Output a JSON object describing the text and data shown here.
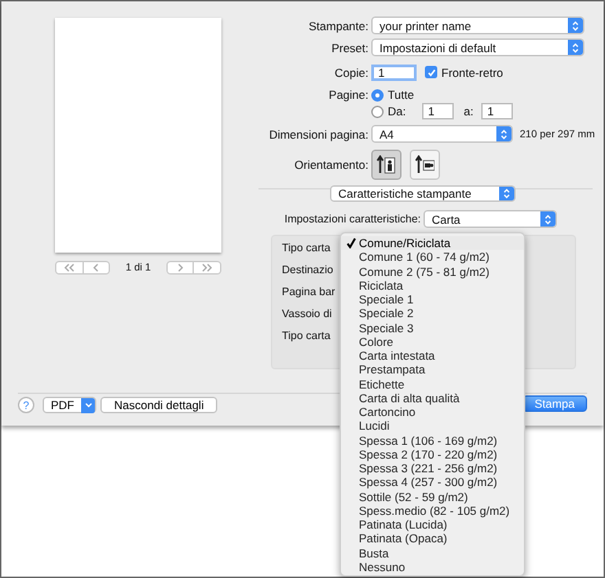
{
  "preview": {
    "page_indicator": "1 di 1"
  },
  "printer": {
    "label": "Stampante:",
    "value": "your printer name"
  },
  "preset": {
    "label": "Preset:",
    "value": "Impostazioni di default"
  },
  "copies": {
    "label": "Copie:",
    "value": "1",
    "duplex": {
      "label": "Fronte-retro",
      "checked": true
    }
  },
  "pages": {
    "label": "Pagine:",
    "options": [
      {
        "label": "Tutte",
        "selected": true
      },
      {
        "label": "Da:",
        "selected": false
      }
    ],
    "from": "1",
    "to_label": "a:",
    "to": "1"
  },
  "page_size": {
    "label": "Dimensioni pagina:",
    "value": "A4",
    "dimensions": "210 per 297 mm"
  },
  "orientation": {
    "label": "Orientamento:",
    "options": [
      {
        "kind": "portrait",
        "selected": true
      },
      {
        "kind": "landscape",
        "selected": false
      }
    ]
  },
  "section_popup": "Caratteristiche stampante",
  "feature_set": {
    "label": "Impostazioni caratteristiche:",
    "value": "Carta"
  },
  "feature_labels": [
    "Tipo carta",
    "Destinazio",
    "Pagina bar",
    "Vassoio di",
    "Tipo carta"
  ],
  "paper_menu": [
    {
      "label": "Comune/Riciclata",
      "selected": true
    },
    {
      "label": "Comune 1 (60 - 74 g/m2)",
      "selected": false
    },
    {
      "label": "Comune 2 (75 - 81 g/m2)",
      "selected": false
    },
    {
      "label": "Riciclata",
      "selected": false
    },
    {
      "label": "Speciale 1",
      "selected": false
    },
    {
      "label": "Speciale 2",
      "selected": false
    },
    {
      "label": "Speciale 3",
      "selected": false
    },
    {
      "label": "Colore",
      "selected": false
    },
    {
      "label": "Carta intestata",
      "selected": false
    },
    {
      "label": "Prestampata",
      "selected": false
    },
    {
      "label": "Etichette",
      "selected": false
    },
    {
      "label": "Carta di alta qualità",
      "selected": false
    },
    {
      "label": "Cartoncino",
      "selected": false
    },
    {
      "label": "Lucidi",
      "selected": false
    },
    {
      "label": "Spessa 1 (106 - 169 g/m2)",
      "selected": false
    },
    {
      "label": "Spessa 2 (170 - 220 g/m2)",
      "selected": false
    },
    {
      "label": "Spessa 3 (221 - 256 g/m2)",
      "selected": false
    },
    {
      "label": "Spessa 4 (257 - 300 g/m2)",
      "selected": false
    },
    {
      "label": "Sottile (52 - 59 g/m2)",
      "selected": false
    },
    {
      "label": "Spess.medio (82 - 105 g/m2)",
      "selected": false
    },
    {
      "label": "Patinata (Lucida)",
      "selected": false
    },
    {
      "label": "Patinata (Opaca)",
      "selected": false
    },
    {
      "label": "Busta",
      "selected": false
    },
    {
      "label": "Nessuno",
      "selected": false
    }
  ],
  "footer": {
    "help": "?",
    "pdf": "PDF",
    "hide_details": "Nascondi dettagli",
    "print": "Stampa"
  }
}
